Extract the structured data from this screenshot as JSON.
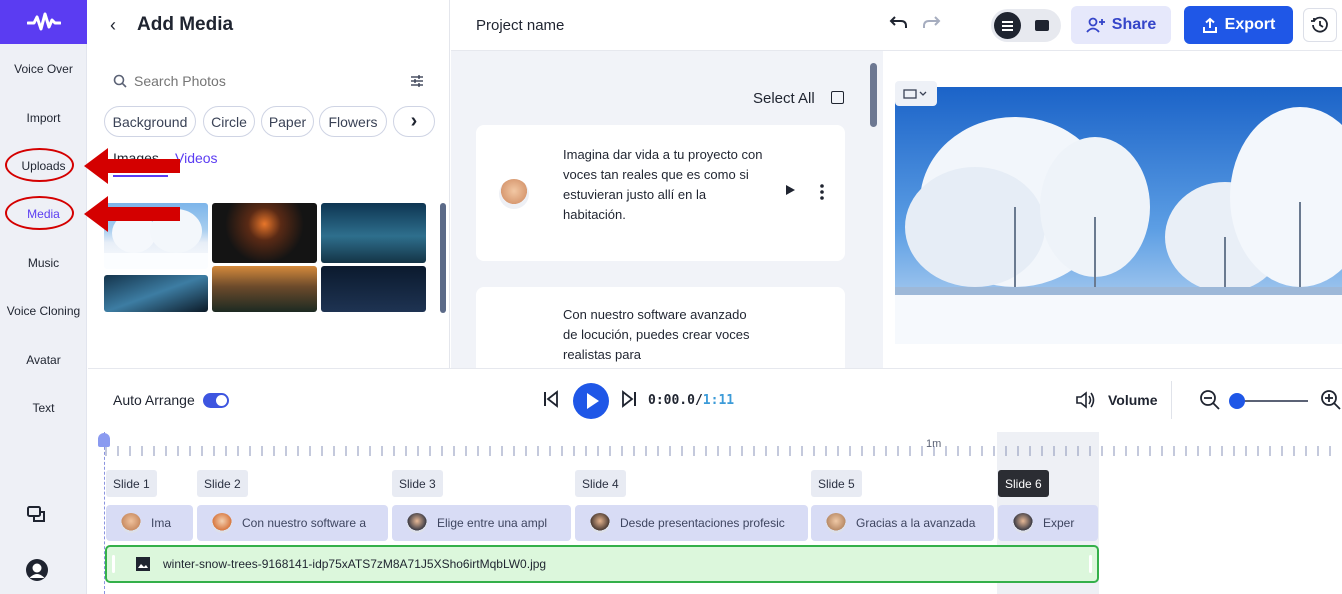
{
  "rail": {
    "items": [
      {
        "label": "Voice Over"
      },
      {
        "label": "Import"
      },
      {
        "label": "Uploads"
      },
      {
        "label": "Media"
      },
      {
        "label": "Music"
      },
      {
        "label": "Voice Cloning"
      },
      {
        "label": "Avatar"
      },
      {
        "label": "Text"
      }
    ]
  },
  "media": {
    "title": "Add Media",
    "search_placeholder": "Search Photos",
    "chips": [
      "Background",
      "Circle",
      "Paper",
      "Flowers"
    ],
    "tabs": [
      "Images",
      "Videos"
    ]
  },
  "header": {
    "project_name": "Project name",
    "share_label": "Share",
    "export_label": "Export"
  },
  "script": {
    "select_all_label": "Select All",
    "cards": [
      {
        "text": "Imagina dar vida a tu proyecto con voces tan reales que es como si estuvieran justo allí en la habitación."
      },
      {
        "text": "Con nuestro software avanzado de locución, puedes crear voces realistas para"
      }
    ]
  },
  "controls": {
    "auto_arrange_label": "Auto Arrange",
    "time_current": "0:00.0",
    "time_separator": "/",
    "time_total": "1:11",
    "volume_label": "Volume"
  },
  "timeline": {
    "ruler_label": "1m",
    "slides": [
      {
        "label": "Slide 1",
        "clip": "Ima"
      },
      {
        "label": "Slide 2",
        "clip": "Con nuestro software a"
      },
      {
        "label": "Slide 3",
        "clip": "Elige entre una ampl"
      },
      {
        "label": "Slide 4",
        "clip": "Desde presentaciones profesic"
      },
      {
        "label": "Slide 5",
        "clip": "Gracias a la avanzada"
      },
      {
        "label": "Slide 6",
        "clip": "Exper"
      }
    ],
    "media_clip": "winter-snow-trees-9168141-idp75xATS7zM8A71J5XSho6irtMqbLW0.jpg"
  },
  "colors": {
    "brand": "#5b3cf2",
    "accent": "#1f57e7",
    "annotation": "#d40000"
  }
}
